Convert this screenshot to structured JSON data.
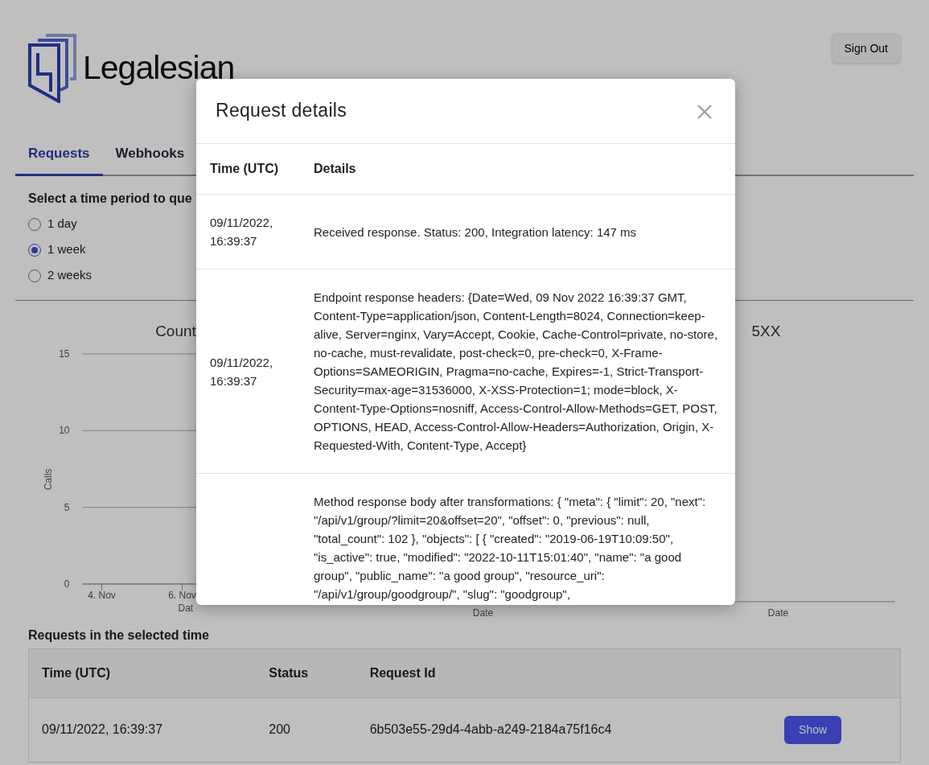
{
  "brand": {
    "name": "Legalesian"
  },
  "sign_out": {
    "label": "Sign Out"
  },
  "tabs": [
    {
      "label": "Requests",
      "selected": true
    },
    {
      "label": "Webhooks",
      "selected": false
    }
  ],
  "period": {
    "label": "Select a time period to que",
    "options": [
      {
        "label": "1 day",
        "selected": false
      },
      {
        "label": "1 week",
        "selected": true
      },
      {
        "label": "2 weeks",
        "selected": false
      }
    ]
  },
  "charts": [
    {
      "title": "Count",
      "ylabel": "Calls",
      "yticks": [
        "15",
        "10",
        "5",
        "0"
      ],
      "xticks": [
        "4. Nov",
        "6. Nov"
      ],
      "xlabel": "Dat"
    },
    {
      "xlabel": "Date"
    },
    {
      "title": "5XX",
      "xlabel": "Date"
    }
  ],
  "requests": {
    "heading": "Requests in the selected time",
    "columns": [
      "Time (UTC)",
      "Status",
      "Request Id"
    ],
    "rows": [
      {
        "time": "09/11/2022, 16:39:37",
        "status": "200",
        "request_id": "6b503e55-29d4-4abb-a249-2184a75f16c4",
        "action": "Show"
      }
    ]
  },
  "modal": {
    "title": "Request details",
    "columns": [
      "Time (UTC)",
      "Details"
    ],
    "rows": [
      {
        "time": "09/11/2022, 16:39:37",
        "details": "Received response. Status: 200, Integration latency: 147 ms"
      },
      {
        "time": "09/11/2022, 16:39:37",
        "details": "Endpoint response headers: {Date=Wed, 09 Nov 2022 16:39:37 GMT, Content-Type=application/json, Content-Length=8024, Connection=keep-alive, Server=nginx, Vary=Accept, Cookie, Cache-Control=private, no-store, no-cache, must-revalidate, post-check=0, pre-check=0, X-Frame-Options=SAMEORIGIN, Pragma=no-cache, Expires=-1, Strict-Transport-Security=max-age=31536000, X-XSS-Protection=1; mode=block, X-Content-Type-Options=nosniff, Access-Control-Allow-Methods=GET, POST, OPTIONS, HEAD, Access-Control-Allow-Headers=Authorization, Origin, X-Requested-With, Content-Type, Accept}"
      },
      {
        "details": "Method response body after transformations: { \"meta\": { \"limit\": 20, \"next\": \"/api/v1/group/?limit=20&offset=20\", \"offset\": 0, \"previous\": null, \"total_count\": 102 }, \"objects\": [ { \"created\": \"2019-06-19T10:09:50\", \"is_active\": true, \"modified\": \"2022-10-11T15:01:40\", \"name\": \"a good group\", \"public_name\": \"a good group\", \"resource_uri\": \"/api/v1/group/goodgroup/\", \"slug\": \"goodgroup\","
      }
    ]
  }
}
